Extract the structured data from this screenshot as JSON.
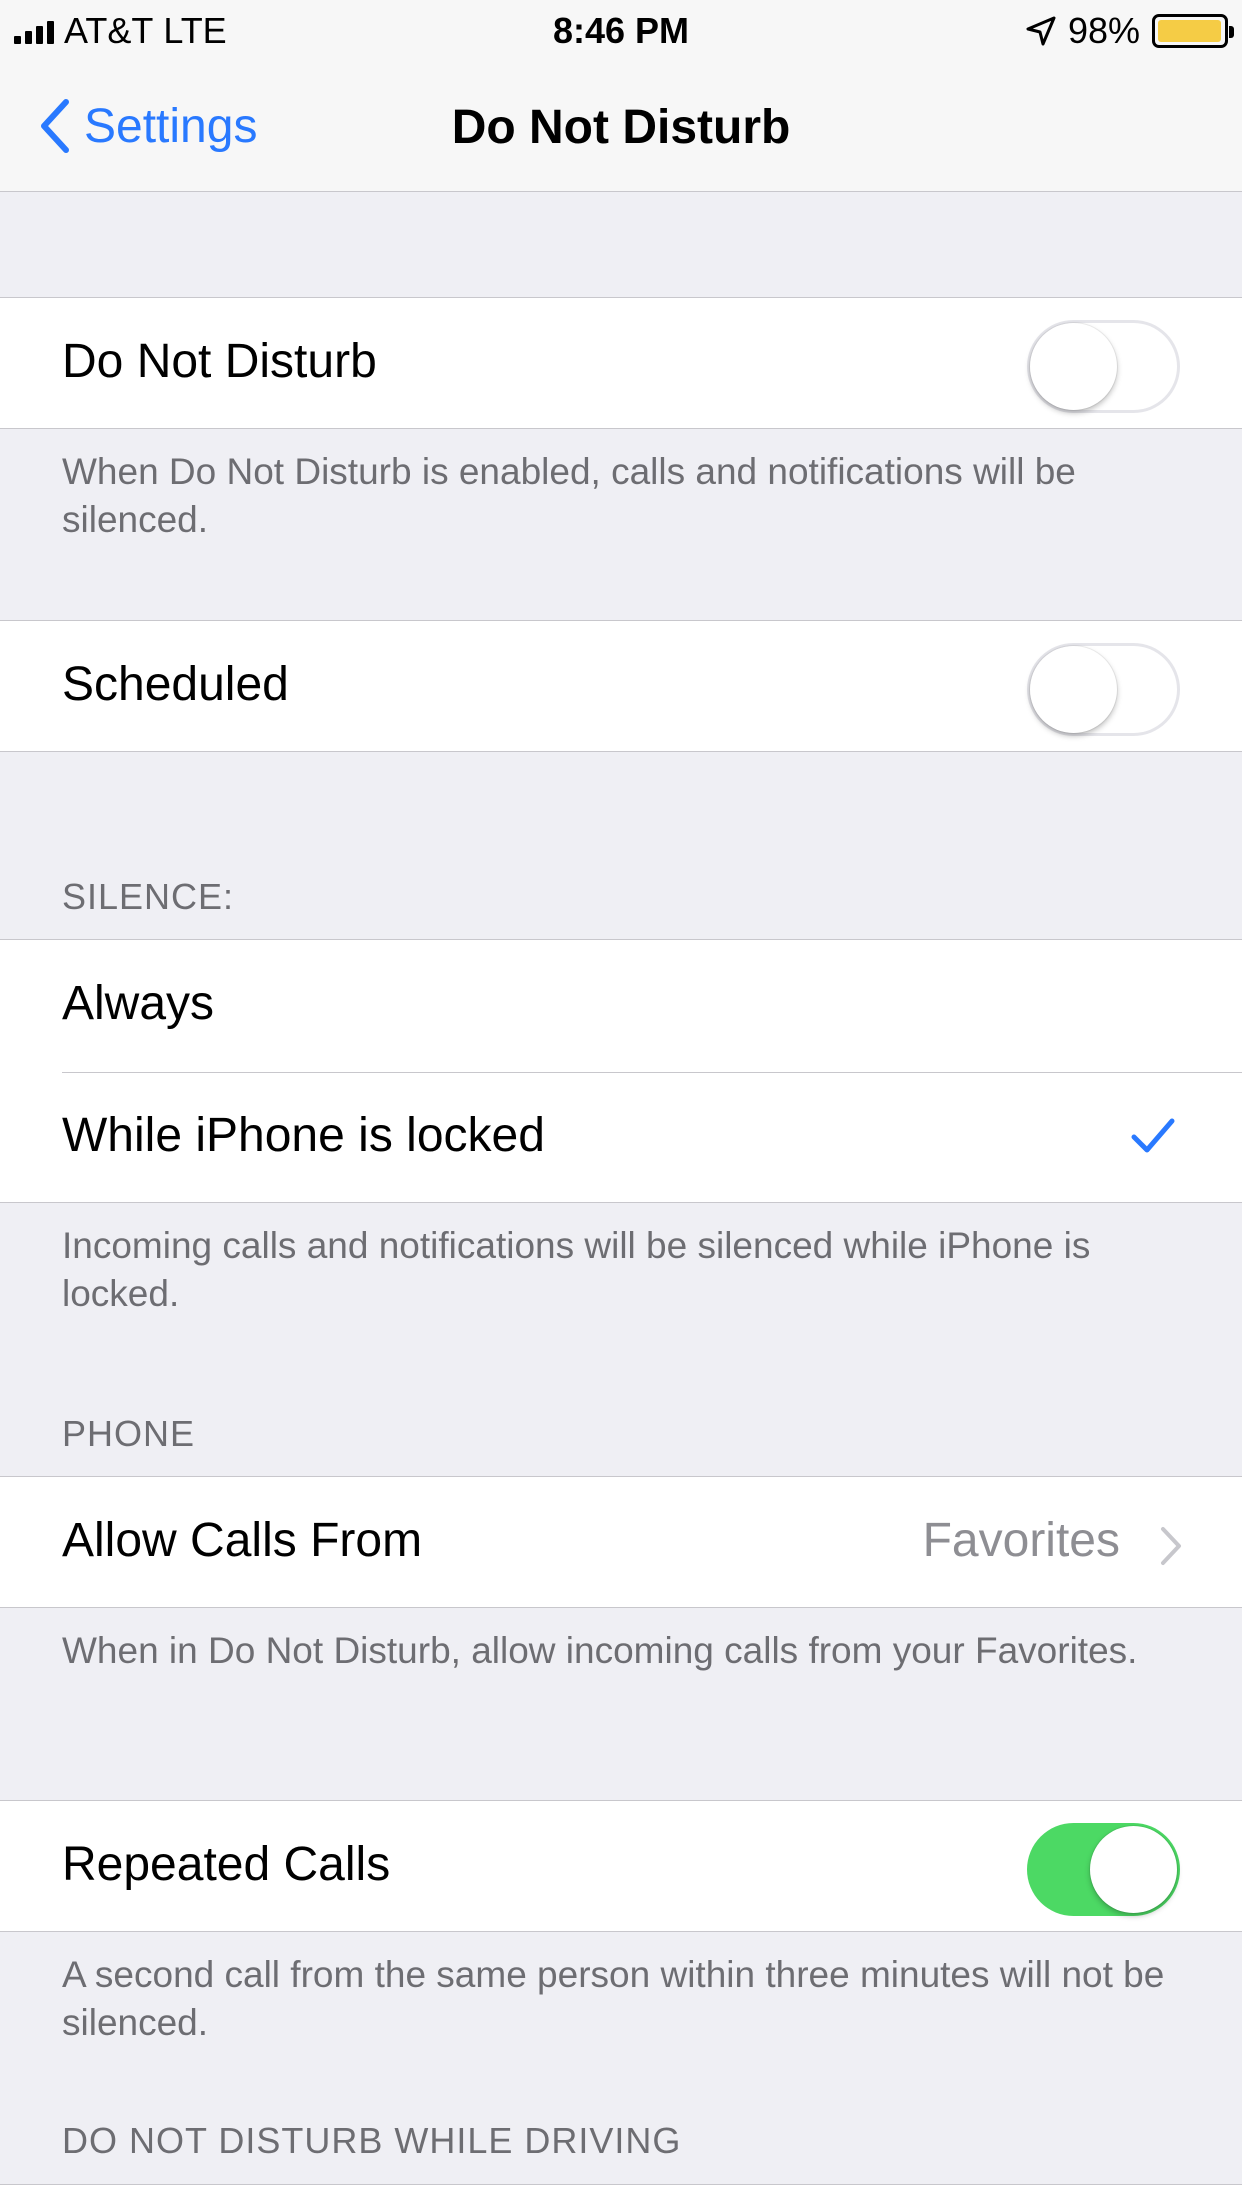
{
  "status_bar": {
    "carrier": "AT&T",
    "network": "LTE",
    "time": "8:46 PM",
    "battery": "98%",
    "battery_level": 0.98
  },
  "nav": {
    "back_label": "Settings",
    "title": "Do Not Disturb"
  },
  "dnd": {
    "label": "Do Not Disturb",
    "on": false,
    "footer": "When Do Not Disturb is enabled, calls and notifications will be silenced."
  },
  "scheduled": {
    "label": "Scheduled",
    "on": false
  },
  "silence": {
    "header": "SILENCE:",
    "always": "Always",
    "locked": "While iPhone is locked",
    "selected": "While iPhone is locked",
    "footer": "Incoming calls and notifications will be silenced while iPhone is locked."
  },
  "phone": {
    "header": "PHONE",
    "allow_calls_label": "Allow Calls From",
    "allow_calls_value": "Favorites",
    "allow_calls_footer": "When in Do Not Disturb, allow incoming calls from your Favorites.",
    "repeated_label": "Repeated Calls",
    "repeated_on": true,
    "repeated_footer": "A second call from the same person within three minutes will not be silenced."
  },
  "driving": {
    "header": "DO NOT DISTURB WHILE DRIVING"
  },
  "colors": {
    "accent": "#2979ff",
    "switch_on": "#4cd964",
    "battery": "#f5cc45",
    "group_bg": "#efeff4"
  }
}
